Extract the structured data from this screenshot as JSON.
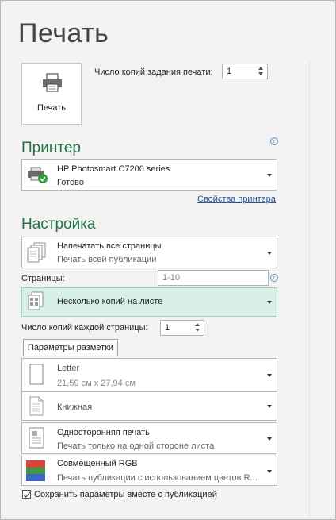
{
  "title": "Печать",
  "print_button": {
    "label": "Печать"
  },
  "copies": {
    "label": "Число копий задания печати:",
    "value": "1"
  },
  "printer": {
    "section_title": "Принтер",
    "name": "HP Photosmart C7200 series",
    "status": "Готово",
    "properties_link": "Свойства принтера"
  },
  "settings": {
    "section_title": "Настройка",
    "page_range": {
      "title": "Напечатать все страницы",
      "subtitle": "Печать всей публикации"
    },
    "pages": {
      "label": "Страницы:",
      "placeholder": "1-10"
    },
    "layout": {
      "title": "Несколько копий на листе"
    },
    "copies_per_page": {
      "label": "Число копий каждой страницы:",
      "value": "1"
    },
    "layout_options_button": "Параметры разметки",
    "paper": {
      "title": "Letter",
      "subtitle": "21,59 см x 27,94 см"
    },
    "orientation": {
      "title": "Книжная"
    },
    "sides": {
      "title": "Односторонняя печать",
      "subtitle": "Печать только на одной стороне листа"
    },
    "color": {
      "title": "Совмещенный RGB",
      "subtitle": "Печать публикации с использованием цветов R..."
    },
    "save_settings": "Сохранить параметры вместе с публикацией"
  },
  "colors": {
    "accent_green": "#217346",
    "highlight": "#d8efe6",
    "link": "#2a5699"
  }
}
